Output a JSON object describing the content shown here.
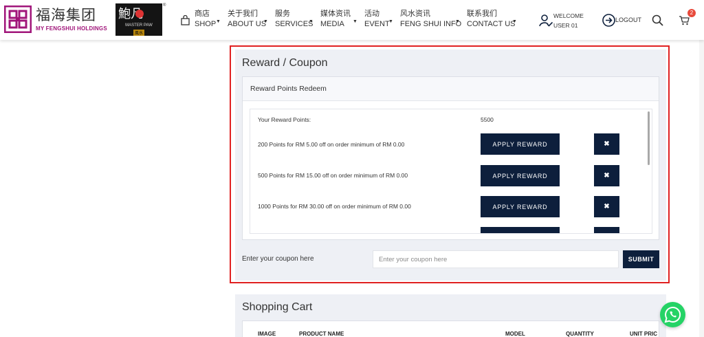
{
  "brand": {
    "name_cn": "福海集团",
    "name_en": "MY FENGSHUI HOLDINGS",
    "partner_cn": "鮑凡",
    "partner_en": "MASTER PAW",
    "partner_tag": "風水",
    "reg_mark": "®"
  },
  "nav": {
    "items": [
      {
        "cn": "商店",
        "en": "SHOP"
      },
      {
        "cn": "关于我们",
        "en": "ABOUT US"
      },
      {
        "cn": "服务",
        "en": "SERVICES"
      },
      {
        "cn": "媒体资讯",
        "en": "MEDIA"
      },
      {
        "cn": "活动",
        "en": "EVENT"
      },
      {
        "cn": "风水资讯",
        "en": "FENG SHUI INFO"
      },
      {
        "cn": "联系我们",
        "en": "CONTACT US"
      }
    ],
    "welcome_line1": "WELCOME",
    "welcome_line2": "USER 01",
    "logout": "LOGOUT",
    "cart_count": "2"
  },
  "reward": {
    "title": "Reward / Coupon",
    "panel_title": "Reward Points Redeem",
    "points_label": "Your Reward Points:",
    "points_value": "5500",
    "apply_label": "APPLY REWARD",
    "remove_symbol": "✖",
    "options": [
      {
        "label": "200 Points for RM 5.00 off on order minimum of RM 0.00"
      },
      {
        "label": "500 Points for RM 15.00 off on order minimum of RM 0.00"
      },
      {
        "label": "1000 Points for RM 30.00 off on order minimum of RM 0.00"
      },
      {
        "label": ""
      }
    ]
  },
  "coupon": {
    "label": "Enter your coupon here",
    "placeholder": "Enter your coupon here",
    "value": "",
    "submit": "SUBMIT"
  },
  "cart": {
    "title": "Shopping Cart",
    "columns": [
      "IMAGE",
      "PRODUCT NAME",
      "MODEL",
      "QUANTITY",
      "UNIT PRIC"
    ]
  },
  "colors": {
    "primary_button": "#0d1f3c",
    "highlight_outline": "#e02020",
    "brand_accent": "#a0157a",
    "whatsapp": "#25d366",
    "badge": "#e84b3c"
  }
}
